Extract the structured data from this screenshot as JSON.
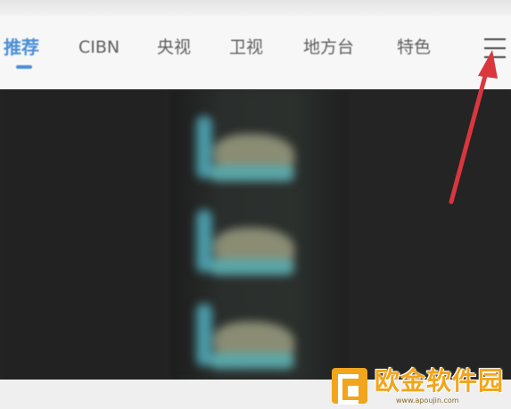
{
  "tabs": [
    {
      "label": "推荐",
      "active": true
    },
    {
      "label": "CIBN",
      "active": false
    },
    {
      "label": "央视",
      "active": false
    },
    {
      "label": "卫视",
      "active": false
    },
    {
      "label": "地方台",
      "active": false
    },
    {
      "label": "特色",
      "active": false
    }
  ],
  "menu": {
    "icon": "hamburger-menu-icon"
  },
  "annotation": {
    "arrow_color": "#d9363e",
    "points_to": "hamburger-menu-icon"
  },
  "video": {
    "state": "blurred-preview"
  },
  "watermark": {
    "brand_text": "欧金软件园",
    "url": "www.apoujin.com",
    "color": "#f1a51c"
  },
  "colors": {
    "accent": "#4a8fd8",
    "tab_text": "#5e5e5e"
  }
}
